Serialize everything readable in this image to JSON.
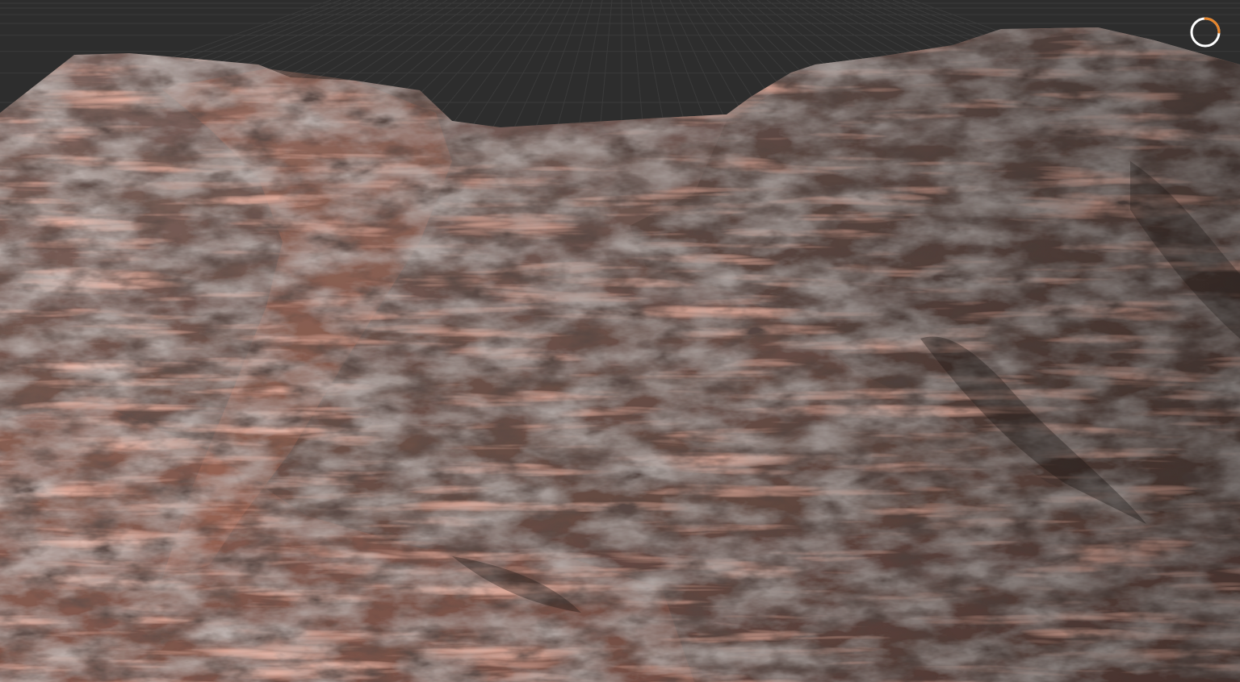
{
  "viewport": {
    "label": "",
    "background_color": "#2d2d2d",
    "grid_line_color": "#3b3b3b"
  },
  "terrain": {
    "palette": {
      "shadow": "#3a2d2a",
      "mid_brown": "#7a5a52",
      "dust_gray": "#948682",
      "rust": "#b5705c",
      "highlight": "#d89a80"
    }
  },
  "loading_indicator": {
    "icon": "loading-spinner-icon",
    "ring_color": "#ffffff",
    "accent_color": "#e8852a",
    "progress": 0.25
  }
}
